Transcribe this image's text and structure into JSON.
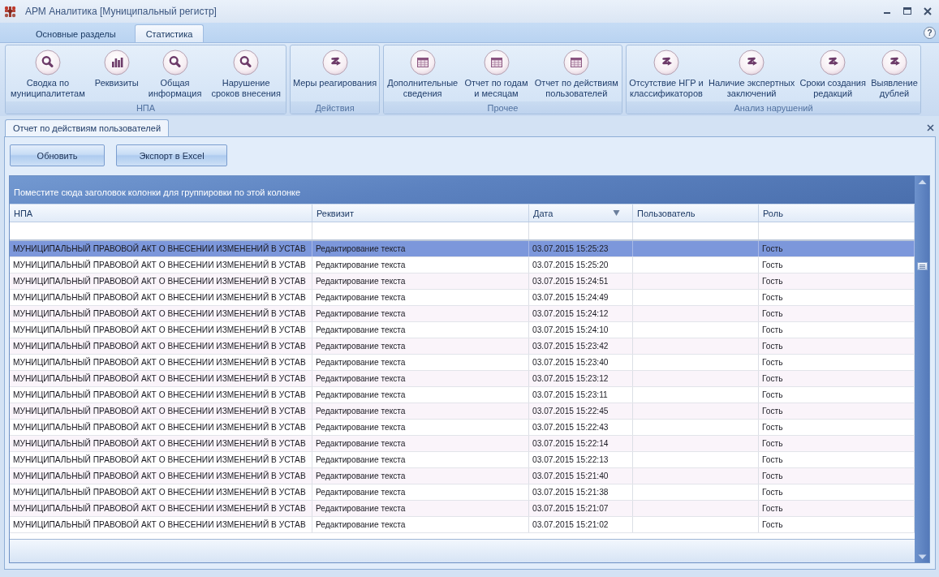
{
  "window": {
    "title": "АРМ Аналитика [Муниципальный регистр]"
  },
  "ribbon": {
    "tabs": [
      {
        "label": "Основные разделы",
        "selected": false
      },
      {
        "label": "Статистика",
        "selected": true
      }
    ],
    "help": "?",
    "groups": [
      {
        "label": "НПА",
        "buttons": [
          {
            "label": "Сводка по\nмуниципалитетам",
            "kind": "magnifier"
          },
          {
            "label": "Реквизиты",
            "kind": "chart"
          },
          {
            "label": "Общая\nинформация",
            "kind": "magnifier"
          },
          {
            "label": "Нарушение\nсроков внесения",
            "kind": "magnifier"
          }
        ]
      },
      {
        "label": "Действия",
        "buttons": [
          {
            "label": "Меры реагирования",
            "kind": "zigzag"
          }
        ]
      },
      {
        "label": "Прочее",
        "buttons": [
          {
            "label": "Дополнительные\nсведения",
            "kind": "table"
          },
          {
            "label": "Отчет по годам\nи месяцам",
            "kind": "table"
          },
          {
            "label": "Отчет по действиям\nпользователей",
            "kind": "table"
          }
        ]
      },
      {
        "label": "Анализ нарушений",
        "buttons": [
          {
            "label": "Отсутствие НГР и\nклассификаторов",
            "kind": "zigzag"
          },
          {
            "label": "Наличие экспертных\nзаключений",
            "kind": "zigzag"
          },
          {
            "label": "Сроки создания\nредакций",
            "kind": "zigzag"
          },
          {
            "label": "Выявление\nдублей",
            "kind": "zigzag"
          }
        ]
      }
    ]
  },
  "document_tabs": [
    {
      "label": "Отчет по действиям пользователей",
      "selected": true
    }
  ],
  "toolbar": {
    "buttons": [
      "Обновить",
      "Экспорт в Excel"
    ]
  },
  "grid": {
    "group_panel_hint": "Поместите сюда заголовок колонки для группировки по этой колонке",
    "columns": [
      {
        "label": "НПА",
        "sort_descending": false
      },
      {
        "label": "Реквизит",
        "sort_descending": false
      },
      {
        "label": "Дата",
        "sort_descending": true
      },
      {
        "label": "Пользователь",
        "sort_descending": false
      },
      {
        "label": "Роль",
        "sort_descending": false
      }
    ],
    "rows": [
      {
        "npa": "МУНИЦИПАЛЬНЫЙ ПРАВОВОЙ АКТ О ВНЕСЕНИИ ИЗМЕНЕНИЙ В УСТАВ",
        "requisite": "Редактирование текста",
        "date": "03.07.2015 15:25:23",
        "role": "Гость",
        "selected": true
      },
      {
        "npa": "МУНИЦИПАЛЬНЫЙ ПРАВОВОЙ АКТ О ВНЕСЕНИИ ИЗМЕНЕНИЙ В УСТАВ",
        "requisite": "Редактирование текста",
        "date": "03.07.2015 15:25:20",
        "role": "Гость",
        "selected": false
      },
      {
        "npa": "МУНИЦИПАЛЬНЫЙ ПРАВОВОЙ АКТ О ВНЕСЕНИИ ИЗМЕНЕНИЙ В УСТАВ",
        "requisite": "Редактирование текста",
        "date": "03.07.2015 15:24:51",
        "role": "Гость",
        "selected": false
      },
      {
        "npa": "МУНИЦИПАЛЬНЫЙ ПРАВОВОЙ АКТ О ВНЕСЕНИИ ИЗМЕНЕНИЙ В УСТАВ",
        "requisite": "Редактирование текста",
        "date": "03.07.2015 15:24:49",
        "role": "Гость",
        "selected": false
      },
      {
        "npa": "МУНИЦИПАЛЬНЫЙ ПРАВОВОЙ АКТ О ВНЕСЕНИИ ИЗМЕНЕНИЙ В УСТАВ",
        "requisite": "Редактирование текста",
        "date": "03.07.2015 15:24:12",
        "role": "Гость",
        "selected": false
      },
      {
        "npa": "МУНИЦИПАЛЬНЫЙ ПРАВОВОЙ АКТ О ВНЕСЕНИИ ИЗМЕНЕНИЙ В УСТАВ",
        "requisite": "Редактирование текста",
        "date": "03.07.2015 15:24:10",
        "role": "Гость",
        "selected": false
      },
      {
        "npa": "МУНИЦИПАЛЬНЫЙ ПРАВОВОЙ АКТ О ВНЕСЕНИИ ИЗМЕНЕНИЙ В УСТАВ",
        "requisite": "Редактирование текста",
        "date": "03.07.2015 15:23:42",
        "role": "Гость",
        "selected": false
      },
      {
        "npa": "МУНИЦИПАЛЬНЫЙ ПРАВОВОЙ АКТ О ВНЕСЕНИИ ИЗМЕНЕНИЙ В УСТАВ",
        "requisite": "Редактирование текста",
        "date": "03.07.2015 15:23:40",
        "role": "Гость",
        "selected": false
      },
      {
        "npa": "МУНИЦИПАЛЬНЫЙ ПРАВОВОЙ АКТ О ВНЕСЕНИИ ИЗМЕНЕНИЙ В УСТАВ",
        "requisite": "Редактирование текста",
        "date": "03.07.2015 15:23:12",
        "role": "Гость",
        "selected": false
      },
      {
        "npa": "МУНИЦИПАЛЬНЫЙ ПРАВОВОЙ АКТ О ВНЕСЕНИИ ИЗМЕНЕНИЙ В УСТАВ",
        "requisite": "Редактирование текста",
        "date": "03.07.2015 15:23:11",
        "role": "Гость",
        "selected": false
      },
      {
        "npa": "МУНИЦИПАЛЬНЫЙ ПРАВОВОЙ АКТ О ВНЕСЕНИИ ИЗМЕНЕНИЙ В УСТАВ",
        "requisite": "Редактирование текста",
        "date": "03.07.2015 15:22:45",
        "role": "Гость",
        "selected": false
      },
      {
        "npa": "МУНИЦИПАЛЬНЫЙ ПРАВОВОЙ АКТ О ВНЕСЕНИИ ИЗМЕНЕНИЙ В УСТАВ",
        "requisite": "Редактирование текста",
        "date": "03.07.2015 15:22:43",
        "role": "Гость",
        "selected": false
      },
      {
        "npa": "МУНИЦИПАЛЬНЫЙ ПРАВОВОЙ АКТ О ВНЕСЕНИИ ИЗМЕНЕНИЙ В УСТАВ",
        "requisite": "Редактирование текста",
        "date": "03.07.2015 15:22:14",
        "role": "Гость",
        "selected": false
      },
      {
        "npa": "МУНИЦИПАЛЬНЫЙ ПРАВОВОЙ АКТ О ВНЕСЕНИИ ИЗМЕНЕНИЙ В УСТАВ",
        "requisite": "Редактирование текста",
        "date": "03.07.2015 15:22:13",
        "role": "Гость",
        "selected": false
      },
      {
        "npa": "МУНИЦИПАЛЬНЫЙ ПРАВОВОЙ АКТ О ВНЕСЕНИИ ИЗМЕНЕНИЙ В УСТАВ",
        "requisite": "Редактирование текста",
        "date": "03.07.2015 15:21:40",
        "role": "Гость",
        "selected": false
      },
      {
        "npa": "МУНИЦИПАЛЬНЫЙ ПРАВОВОЙ АКТ О ВНЕСЕНИИ ИЗМЕНЕНИЙ В УСТАВ",
        "requisite": "Редактирование текста",
        "date": "03.07.2015 15:21:38",
        "role": "Гость",
        "selected": false
      },
      {
        "npa": "МУНИЦИПАЛЬНЫЙ ПРАВОВОЙ АКТ О ВНЕСЕНИИ ИЗМЕНЕНИЙ В УСТАВ",
        "requisite": "Редактирование текста",
        "date": "03.07.2015 15:21:07",
        "role": "Гость",
        "selected": false
      },
      {
        "npa": "МУНИЦИПАЛЬНЫЙ ПРАВОВОЙ АКТ О ВНЕСЕНИИ ИЗМЕНЕНИЙ В УСТАВ",
        "requisite": "Редактирование текста",
        "date": "03.07.2015 15:21:02",
        "role": "Гость",
        "selected": false
      }
    ]
  }
}
